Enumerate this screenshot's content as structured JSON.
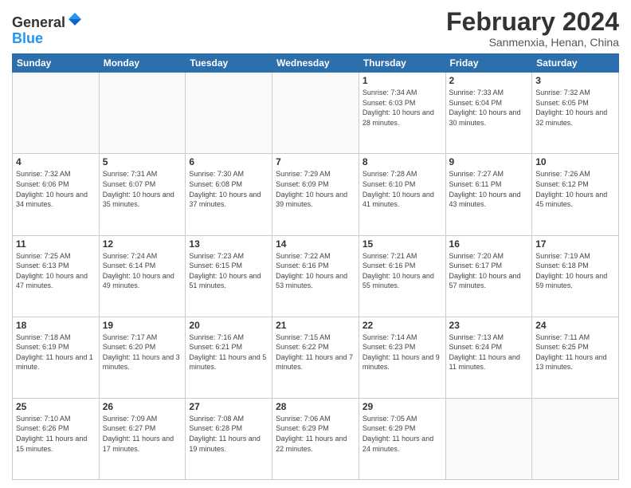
{
  "header": {
    "logo_line1": "General",
    "logo_line2": "Blue",
    "title": "February 2024",
    "subtitle": "Sanmenxia, Henan, China"
  },
  "days_of_week": [
    "Sunday",
    "Monday",
    "Tuesday",
    "Wednesday",
    "Thursday",
    "Friday",
    "Saturday"
  ],
  "weeks": [
    [
      {
        "num": "",
        "info": ""
      },
      {
        "num": "",
        "info": ""
      },
      {
        "num": "",
        "info": ""
      },
      {
        "num": "",
        "info": ""
      },
      {
        "num": "1",
        "info": "Sunrise: 7:34 AM\nSunset: 6:03 PM\nDaylight: 10 hours and 28 minutes."
      },
      {
        "num": "2",
        "info": "Sunrise: 7:33 AM\nSunset: 6:04 PM\nDaylight: 10 hours and 30 minutes."
      },
      {
        "num": "3",
        "info": "Sunrise: 7:32 AM\nSunset: 6:05 PM\nDaylight: 10 hours and 32 minutes."
      }
    ],
    [
      {
        "num": "4",
        "info": "Sunrise: 7:32 AM\nSunset: 6:06 PM\nDaylight: 10 hours and 34 minutes."
      },
      {
        "num": "5",
        "info": "Sunrise: 7:31 AM\nSunset: 6:07 PM\nDaylight: 10 hours and 35 minutes."
      },
      {
        "num": "6",
        "info": "Sunrise: 7:30 AM\nSunset: 6:08 PM\nDaylight: 10 hours and 37 minutes."
      },
      {
        "num": "7",
        "info": "Sunrise: 7:29 AM\nSunset: 6:09 PM\nDaylight: 10 hours and 39 minutes."
      },
      {
        "num": "8",
        "info": "Sunrise: 7:28 AM\nSunset: 6:10 PM\nDaylight: 10 hours and 41 minutes."
      },
      {
        "num": "9",
        "info": "Sunrise: 7:27 AM\nSunset: 6:11 PM\nDaylight: 10 hours and 43 minutes."
      },
      {
        "num": "10",
        "info": "Sunrise: 7:26 AM\nSunset: 6:12 PM\nDaylight: 10 hours and 45 minutes."
      }
    ],
    [
      {
        "num": "11",
        "info": "Sunrise: 7:25 AM\nSunset: 6:13 PM\nDaylight: 10 hours and 47 minutes."
      },
      {
        "num": "12",
        "info": "Sunrise: 7:24 AM\nSunset: 6:14 PM\nDaylight: 10 hours and 49 minutes."
      },
      {
        "num": "13",
        "info": "Sunrise: 7:23 AM\nSunset: 6:15 PM\nDaylight: 10 hours and 51 minutes."
      },
      {
        "num": "14",
        "info": "Sunrise: 7:22 AM\nSunset: 6:16 PM\nDaylight: 10 hours and 53 minutes."
      },
      {
        "num": "15",
        "info": "Sunrise: 7:21 AM\nSunset: 6:16 PM\nDaylight: 10 hours and 55 minutes."
      },
      {
        "num": "16",
        "info": "Sunrise: 7:20 AM\nSunset: 6:17 PM\nDaylight: 10 hours and 57 minutes."
      },
      {
        "num": "17",
        "info": "Sunrise: 7:19 AM\nSunset: 6:18 PM\nDaylight: 10 hours and 59 minutes."
      }
    ],
    [
      {
        "num": "18",
        "info": "Sunrise: 7:18 AM\nSunset: 6:19 PM\nDaylight: 11 hours and 1 minute."
      },
      {
        "num": "19",
        "info": "Sunrise: 7:17 AM\nSunset: 6:20 PM\nDaylight: 11 hours and 3 minutes."
      },
      {
        "num": "20",
        "info": "Sunrise: 7:16 AM\nSunset: 6:21 PM\nDaylight: 11 hours and 5 minutes."
      },
      {
        "num": "21",
        "info": "Sunrise: 7:15 AM\nSunset: 6:22 PM\nDaylight: 11 hours and 7 minutes."
      },
      {
        "num": "22",
        "info": "Sunrise: 7:14 AM\nSunset: 6:23 PM\nDaylight: 11 hours and 9 minutes."
      },
      {
        "num": "23",
        "info": "Sunrise: 7:13 AM\nSunset: 6:24 PM\nDaylight: 11 hours and 11 minutes."
      },
      {
        "num": "24",
        "info": "Sunrise: 7:11 AM\nSunset: 6:25 PM\nDaylight: 11 hours and 13 minutes."
      }
    ],
    [
      {
        "num": "25",
        "info": "Sunrise: 7:10 AM\nSunset: 6:26 PM\nDaylight: 11 hours and 15 minutes."
      },
      {
        "num": "26",
        "info": "Sunrise: 7:09 AM\nSunset: 6:27 PM\nDaylight: 11 hours and 17 minutes."
      },
      {
        "num": "27",
        "info": "Sunrise: 7:08 AM\nSunset: 6:28 PM\nDaylight: 11 hours and 19 minutes."
      },
      {
        "num": "28",
        "info": "Sunrise: 7:06 AM\nSunset: 6:29 PM\nDaylight: 11 hours and 22 minutes."
      },
      {
        "num": "29",
        "info": "Sunrise: 7:05 AM\nSunset: 6:29 PM\nDaylight: 11 hours and 24 minutes."
      },
      {
        "num": "",
        "info": ""
      },
      {
        "num": "",
        "info": ""
      }
    ]
  ]
}
